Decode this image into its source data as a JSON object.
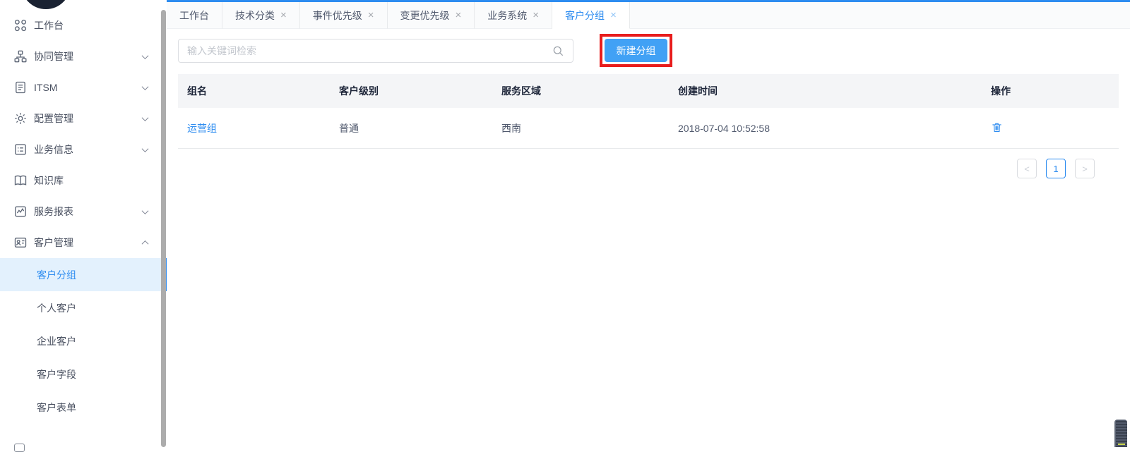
{
  "colors": {
    "accent": "#2d8cf0",
    "button_blue": "#41a1f5",
    "highlight_red": "#e81d1d",
    "submenu_selected_bg": "#e3f1fd",
    "table_header_bg": "#f4f5f7",
    "logo_dark": "#1a2232"
  },
  "sidebar": {
    "items": [
      {
        "icon": "workbench-icon",
        "label": "工作台",
        "chevron": "none"
      },
      {
        "icon": "collaboration-icon",
        "label": "协同管理",
        "chevron": "down"
      },
      {
        "icon": "itsm-doc-icon",
        "label": "ITSM",
        "chevron": "down"
      },
      {
        "icon": "gear-icon",
        "label": "配置管理",
        "chevron": "down"
      },
      {
        "icon": "business-info-icon",
        "label": "业务信息",
        "chevron": "down"
      },
      {
        "icon": "book-icon",
        "label": "知识库",
        "chevron": "none"
      },
      {
        "icon": "report-icon",
        "label": "服务报表",
        "chevron": "down"
      },
      {
        "icon": "customer-icon",
        "label": "客户管理",
        "chevron": "up"
      }
    ],
    "submenu": [
      {
        "label": "客户分组",
        "active": true
      },
      {
        "label": "个人客户",
        "active": false
      },
      {
        "label": "企业客户",
        "active": false
      },
      {
        "label": "客户字段",
        "active": false
      },
      {
        "label": "客户表单",
        "active": false
      }
    ]
  },
  "tabs": {
    "close_glyph": "×",
    "items": [
      {
        "label": "工作台",
        "closable": false,
        "active": false
      },
      {
        "label": "技术分类",
        "closable": true,
        "active": false
      },
      {
        "label": "事件优先级",
        "closable": true,
        "active": false
      },
      {
        "label": "变更优先级",
        "closable": true,
        "active": false
      },
      {
        "label": "业务系统",
        "closable": true,
        "active": false
      },
      {
        "label": "客户分组",
        "closable": true,
        "active": true
      }
    ]
  },
  "toolbar": {
    "search_placeholder": "输入关键词检索",
    "search_icon": "magnifier",
    "new_group_button": "新建分组"
  },
  "table": {
    "headers": [
      "组名",
      "客户级别",
      "服务区域",
      "创建时间",
      "操作"
    ],
    "rows": [
      {
        "group_name": "运营组",
        "customer_level": "普通",
        "service_region": "西南",
        "created_at": "2018-07-04 10:52:58",
        "action_icon": "trash-icon"
      }
    ]
  },
  "pagination": {
    "prev_glyph": "<",
    "current_page": "1",
    "next_glyph": ">"
  }
}
